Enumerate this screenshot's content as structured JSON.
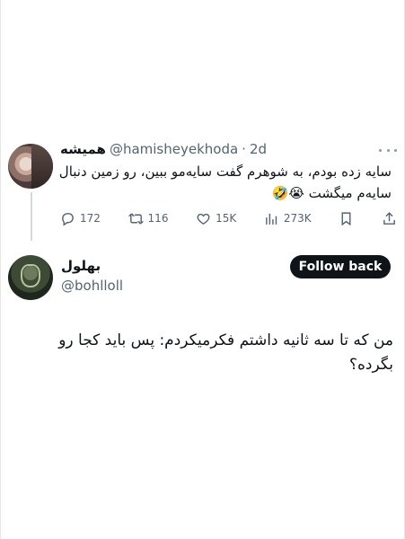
{
  "original_tweet": {
    "display_name": "همیشه",
    "handle": "@hamisheyekhoda",
    "separator": "·",
    "time": "2d",
    "text": "سایه زده بودم، به شوهرم گفت سایه‌مو ببین، رو زمین دنبال سایه‌م میگشت 😭🤣",
    "stats": {
      "replies": "172",
      "retweets": "116",
      "likes": "15K",
      "views": "273K"
    }
  },
  "reply": {
    "display_name": "بهلول",
    "handle": "@bohlloll",
    "follow_label": "Follow back",
    "text": "من که تا سه ثانیه داشتم فکرمیکردم: پس باید کجا رو بگرده؟"
  },
  "colors": {
    "text": "#0f1419",
    "secondary": "#536471",
    "thread_line": "#cfd9de",
    "follow_bg": "#0f1419"
  },
  "icons": [
    "more-icon",
    "reply-icon",
    "retweet-icon",
    "like-icon",
    "views-icon",
    "bookmark-icon",
    "share-icon"
  ]
}
